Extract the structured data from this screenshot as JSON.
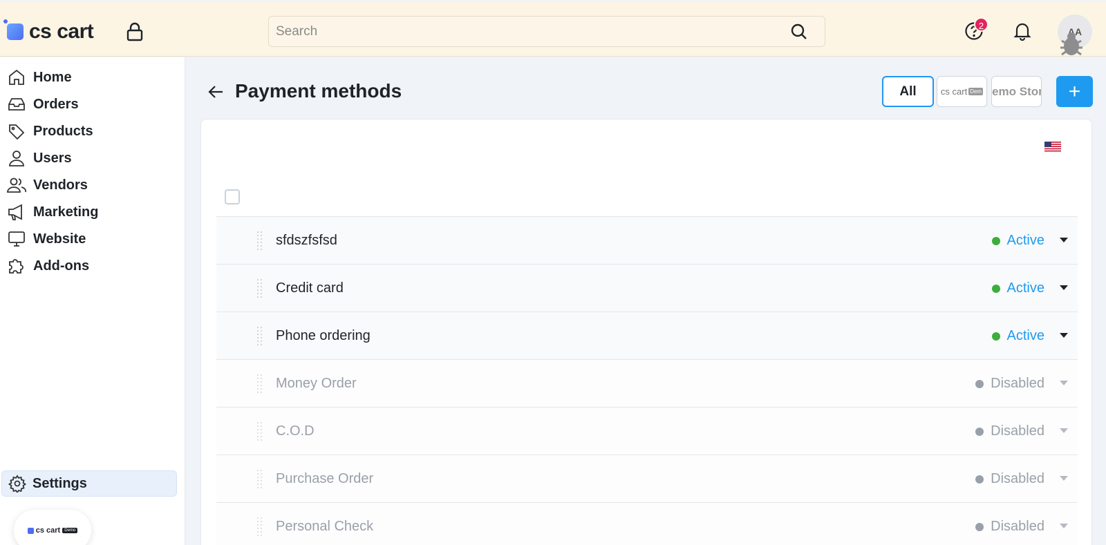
{
  "header": {
    "logo_text": "cs cart",
    "search_placeholder": "Search",
    "help_badge": "2",
    "avatar_initials": "AA"
  },
  "sidebar": {
    "items": [
      {
        "label": "Home",
        "icon": "home-icon"
      },
      {
        "label": "Orders",
        "icon": "inbox-icon"
      },
      {
        "label": "Products",
        "icon": "tag-icon"
      },
      {
        "label": "Users",
        "icon": "user-icon"
      },
      {
        "label": "Vendors",
        "icon": "users-icon"
      },
      {
        "label": "Marketing",
        "icon": "megaphone-icon"
      },
      {
        "label": "Website",
        "icon": "monitor-icon"
      },
      {
        "label": "Add-ons",
        "icon": "puzzle-icon"
      }
    ],
    "settings_label": "Settings",
    "store_chip": {
      "text": "cs cart",
      "tag": "Demo"
    }
  },
  "main": {
    "title": "Payment methods",
    "storefronts": {
      "all": "All",
      "cs_cart": "cs cart",
      "cs_cart_tag": "Dem",
      "demo_store": "Demo Store"
    },
    "add_label": "+",
    "rows": [
      {
        "name": "sfdszfsfsd",
        "status": "Active"
      },
      {
        "name": "Credit card",
        "status": "Active"
      },
      {
        "name": "Phone ordering",
        "status": "Active"
      },
      {
        "name": "Money Order",
        "status": "Disabled"
      },
      {
        "name": "C.O.D",
        "status": "Disabled"
      },
      {
        "name": "Purchase Order",
        "status": "Disabled"
      },
      {
        "name": "Personal Check",
        "status": "Disabled"
      }
    ]
  },
  "colors": {
    "accent": "#1e9bf0",
    "active_dot": "#3cae3c",
    "disabled": "#9aa0a8",
    "header_bg": "#fdf5e4"
  }
}
